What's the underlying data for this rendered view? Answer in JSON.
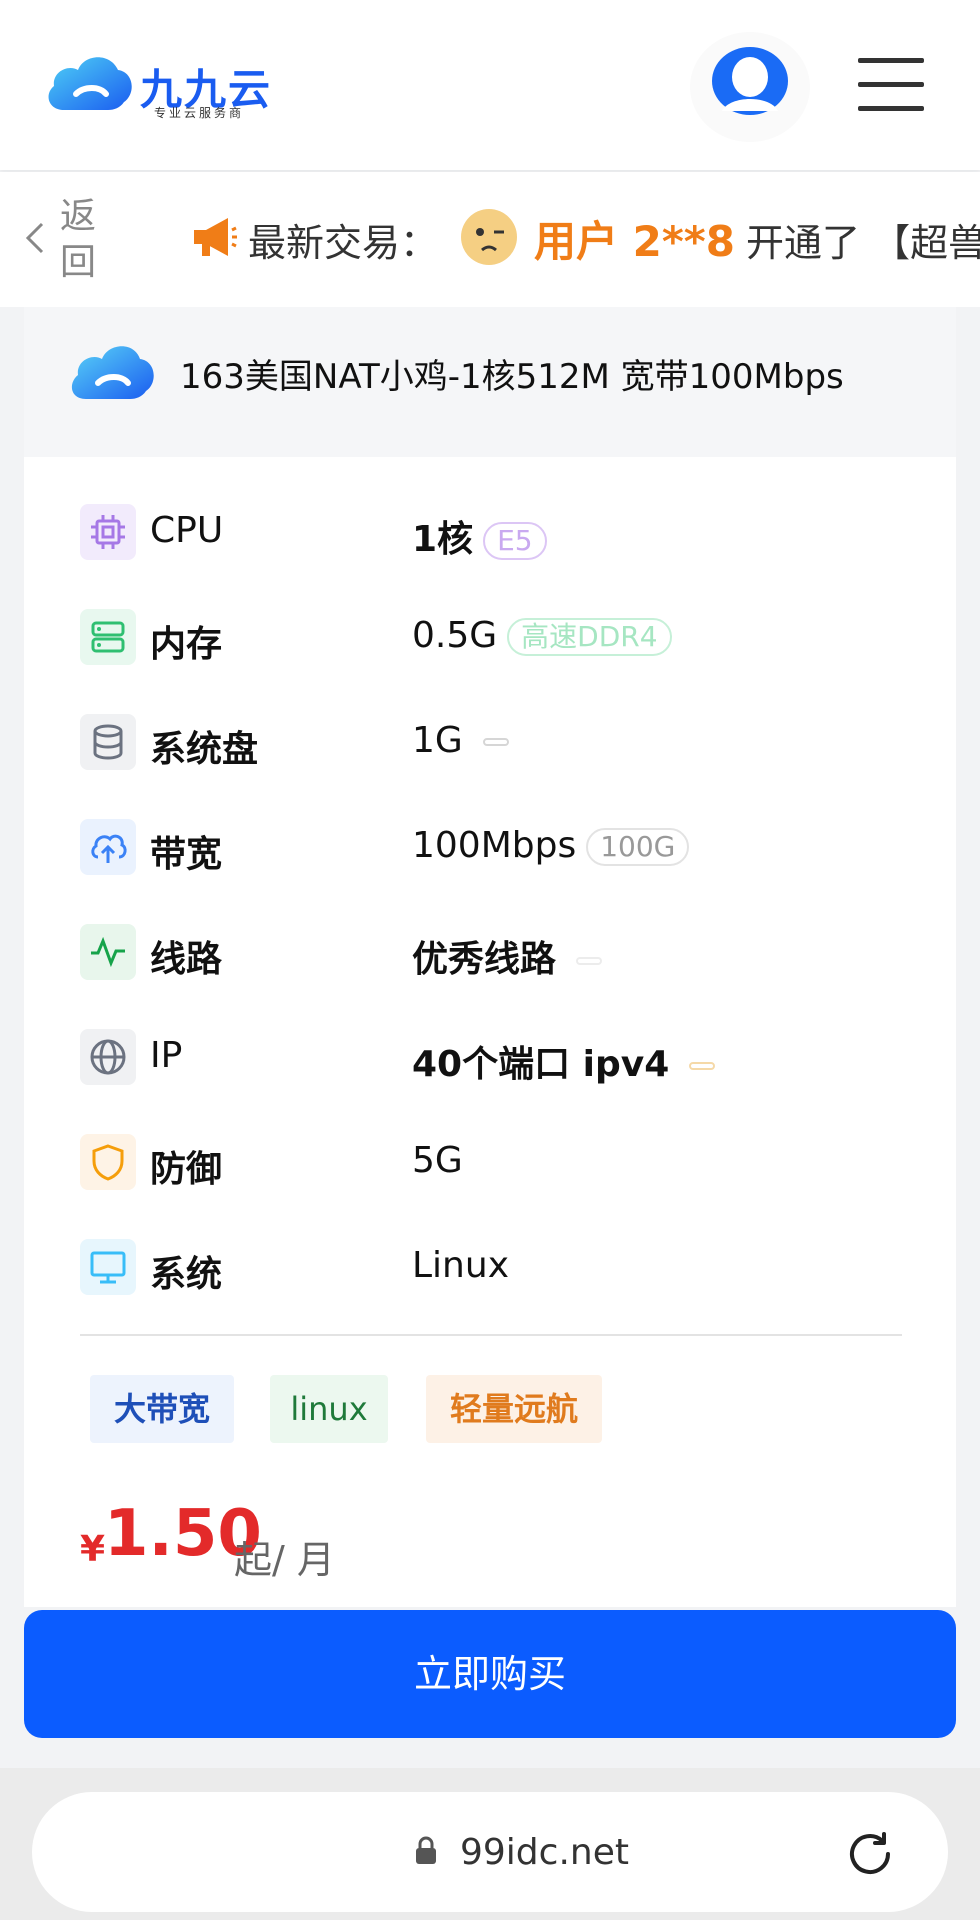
{
  "header": {
    "logo_text": "九九云",
    "logo_subtitle": "专业云服务商"
  },
  "ticker": {
    "back_label": "返回",
    "label": "最新交易：",
    "user": "用户 2**8",
    "action": "开通了 【超兽"
  },
  "product": {
    "title": "163美国NAT小鸡-1核512M 宽带100Mbps",
    "specs": [
      {
        "label": "CPU",
        "value": "1核",
        "badge": "E5",
        "icon": "cpu-icon",
        "color": "#a678e6"
      },
      {
        "label": "内存",
        "value": "0.5G",
        "badge": "高速DDR4",
        "icon": "memory-icon",
        "color": "#2fbf71"
      },
      {
        "label": "系统盘",
        "value": "1G",
        "badge": "",
        "icon": "disk-icon",
        "color": "#6b7280"
      },
      {
        "label": "带宽",
        "value": "100Mbps",
        "badge": "100G",
        "icon": "upload-cloud-icon",
        "color": "#3b82f6"
      },
      {
        "label": "线路",
        "value": "优秀线路",
        "badge": "",
        "icon": "activity-icon",
        "color": "#16a34a"
      },
      {
        "label": "IP",
        "value": "40个端口 ipv4",
        "badge": "",
        "icon": "globe-icon",
        "color": "#6b7280"
      },
      {
        "label": "防御",
        "value": "5G",
        "badge": "",
        "icon": "shield-icon",
        "color": "#f59e0b"
      },
      {
        "label": "系统",
        "value": "Linux",
        "badge": "",
        "icon": "monitor-icon",
        "color": "#38bdf8"
      }
    ],
    "tags": [
      "大带宽",
      "linux",
      "轻量远航"
    ],
    "price": {
      "symbol": "¥",
      "value": "1.50",
      "unit": "起/ 月"
    },
    "buy_label": "立即购买"
  },
  "browser": {
    "url": "99idc.net"
  },
  "colors": {
    "brand": "#1a5cf0",
    "buy_button": "#0b5cff",
    "price": "#e32a2a",
    "ticker_user": "#f07d17"
  }
}
